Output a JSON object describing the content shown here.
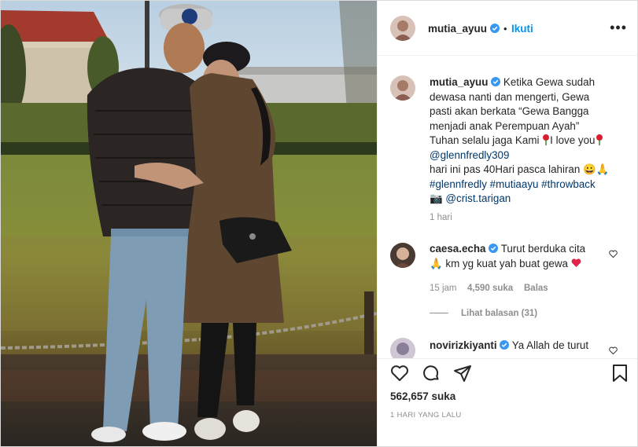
{
  "post": {
    "author": "mutia_ayuu",
    "follow_label": "Ikuti",
    "separator": "•",
    "more_label": "•••"
  },
  "caption": {
    "username": "mutia_ayuu",
    "line1": "Ketika Gewa sudah",
    "line2": "dewasa nanti dan mengerti, Gewa",
    "line3": "pasti akan berkata “Gewa Bangga",
    "line4": "menjadi anak Perempuan Ayah”",
    "line5a": "Tuhan selalu jaga Kami ",
    "line5b": "I love you",
    "mention": "@glennfredly309",
    "line6": "hari ini pas 40Hari pasca lahiran 😀🙏",
    "hashtags": "#glennfredly #mutiaayu #throwback",
    "camera_emoji": "📷",
    "photo_credit": "@crist.tarigan",
    "time": "1 hari"
  },
  "comments": [
    {
      "username": "caesa.echa",
      "text_a": "Turut berduka cita",
      "text_b": "🙏 km yg kuat yah buat gewa ",
      "time": "15 jam",
      "likes": "4,590 suka",
      "reply_label": "Balas",
      "view_replies": "Lihat balasan (31)"
    },
    {
      "username": "novirizkiyanti",
      "text_a": "Ya Allah de turut"
    }
  ],
  "footer": {
    "likes_count": "562,657 suka",
    "date_label": "1 HARI YANG LALU"
  },
  "colors": {
    "link": "#00376b",
    "follow": "#0095f6",
    "verified": "#3897f0",
    "heart_red": "#ed4956",
    "muted": "#8e8e8e"
  },
  "icons": {
    "like": "heart-outline-icon",
    "comment": "comment-bubble-icon",
    "share": "paper-plane-icon",
    "save": "bookmark-icon",
    "verified": "verified-badge-icon",
    "options": "more-options-icon"
  }
}
